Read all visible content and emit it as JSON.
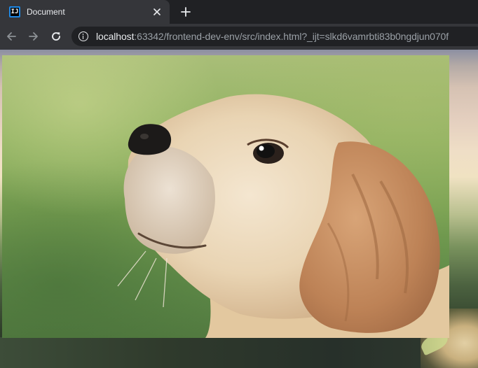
{
  "browser": {
    "tab": {
      "title": "Document",
      "favicon_text": "IJ",
      "close_icon": "close-icon"
    },
    "new_tab_icon": "plus-icon",
    "nav": {
      "back_icon": "arrow-left-icon",
      "forward_icon": "arrow-right-icon",
      "reload_icon": "reload-icon"
    },
    "address": {
      "info_icon": "info-icon",
      "host": "localhost",
      "rest": ":63342/frontend-dev-env/src/index.html?_ijt=slkd6vamrbti83b0ngdjun070f"
    }
  },
  "page": {
    "image_subject": "golden retriever puppy",
    "colors": {
      "tab_bar": "#202124",
      "toolbar": "#35363a",
      "omnibox": "#202124",
      "text": "#e8eaed",
      "url_muted": "#9aa0a6"
    }
  }
}
